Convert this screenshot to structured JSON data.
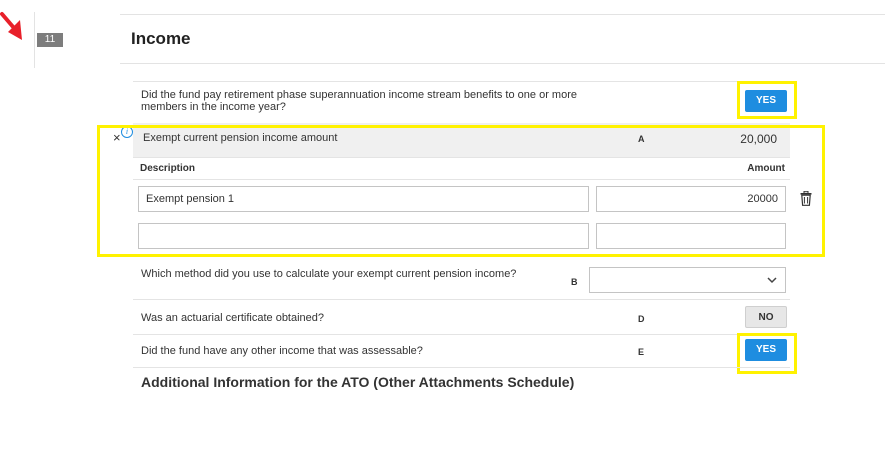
{
  "step": {
    "number": "11"
  },
  "section": {
    "title": "Income"
  },
  "q_income_streams": {
    "text": "Did the fund pay retirement phase superannuation income stream benefits to one or more members in the income year?",
    "answer": "YES"
  },
  "exempt_pension": {
    "close_symbol": "×",
    "info_symbol": "i",
    "label": "Exempt current pension income amount",
    "letter": "A",
    "total": "20,000",
    "columns": {
      "description": "Description",
      "amount": "Amount"
    },
    "rows": [
      {
        "description": "Exempt pension 1",
        "amount": "20000"
      },
      {
        "description": "",
        "amount": ""
      }
    ]
  },
  "q_method": {
    "text": "Which method did you use to calculate your exempt current pension income?",
    "letter": "B",
    "selected": ""
  },
  "q_actuarial": {
    "text": "Was an actuarial certificate obtained?",
    "letter": "D",
    "answer": "NO"
  },
  "q_other_income": {
    "text": "Did the fund have any other income that was assessable?",
    "letter": "E",
    "answer": "YES"
  },
  "additional_info": {
    "heading": "Additional Information for the ATO (Other Attachments Schedule)"
  },
  "colors": {
    "accent_blue": "#1e8de0",
    "highlight_yellow": "#fff200",
    "annotation_red": "#e8202a"
  },
  "icons": {
    "pointer": "red-arrow-icon",
    "delete": "trash-icon",
    "dropdown": "chevron-down-icon",
    "info": "info-icon"
  }
}
